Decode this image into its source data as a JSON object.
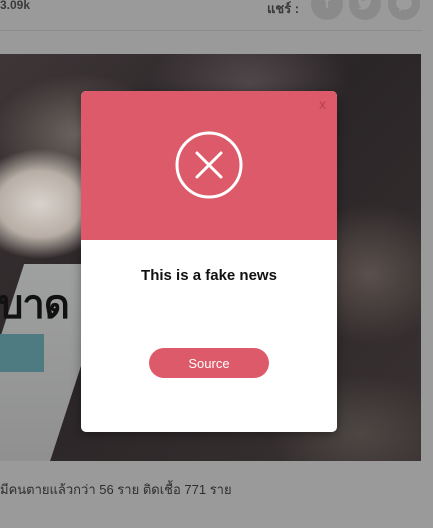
{
  "page": {
    "view_count": "3.09k",
    "share_label": "แชร์ :",
    "share_buttons": [
      {
        "network": "facebook",
        "icon": "facebook-icon",
        "glyph": "f"
      },
      {
        "network": "twitter",
        "icon": "twitter-icon",
        "glyph": ""
      },
      {
        "network": "line",
        "icon": "line-icon",
        "glyph": "LINE"
      }
    ],
    "image_headline": "บาด",
    "caption": "มีคนตายแล้วกว่า 56 ราย ติดเชื้อ 771 ราย"
  },
  "modal": {
    "close_label": "x",
    "status_icon": "x-circle-icon",
    "message": "This is a fake news",
    "source_button": "Source",
    "accent_color": "#dc5a69"
  }
}
